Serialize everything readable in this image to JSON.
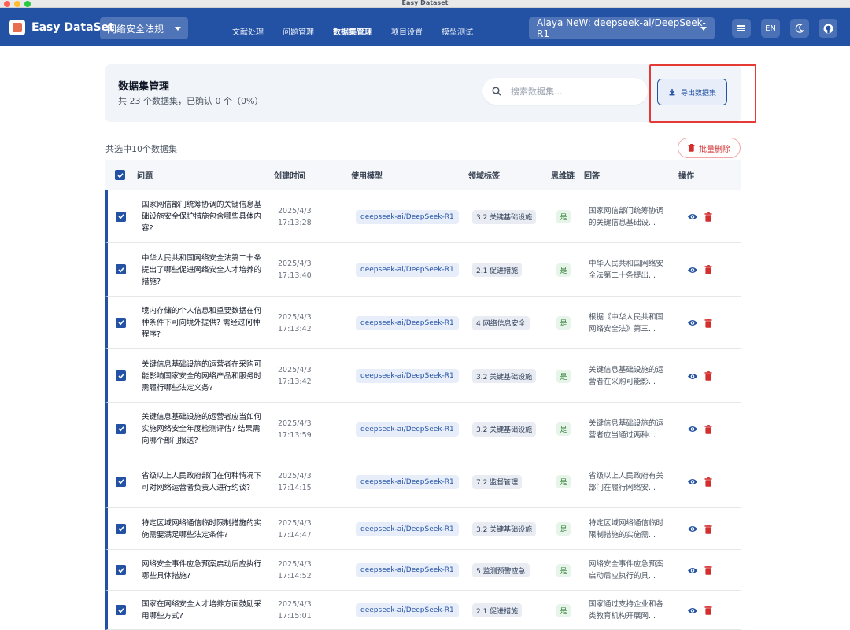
{
  "window": {
    "title": "Easy Dataset"
  },
  "appbar": {
    "app_name": "Easy DataSet",
    "project": "网络安全法规",
    "nav": [
      "文献处理",
      "问题管理",
      "数据集管理",
      "项目设置",
      "模型测试"
    ],
    "active_nav": 2,
    "model": "Alaya NeW: deepseek-ai/DeepSeek-R1",
    "lang": "EN",
    "icons": [
      "list-icon",
      "moon-icon",
      "github-icon"
    ]
  },
  "header": {
    "title": "数据集管理",
    "subtitle": "共 23 个数据集，已确认 0 个（0%）",
    "search_placeholder": "搜索数据集...",
    "export_label": "导出数据集"
  },
  "toolbar": {
    "selected": "共选中10个数据集",
    "batch_delete": "批量删除"
  },
  "table": {
    "columns": [
      "问题",
      "创建时间",
      "使用模型",
      "领域标签",
      "思维链",
      "回答",
      "操作"
    ],
    "rows": [
      {
        "question": "国家网信部门统筹协调的关键信息基础设施安全保护措施包含哪些具体内容?",
        "date": "2025/4/3",
        "time": "17:13:28",
        "model": "deepseek-ai/DeepSeek-R1",
        "tag": "3.2 关键基础设施",
        "cot": "是",
        "answer": "国家网信部门统筹协调的关键信息基础设..."
      },
      {
        "question": "中华人民共和国网络安全法第二十条提出了哪些促进网络安全人才培养的措施?",
        "date": "2025/4/3",
        "time": "17:13:40",
        "model": "deepseek-ai/DeepSeek-R1",
        "tag": "2.1 促进措施",
        "cot": "是",
        "answer": "中华人民共和国网络安全法第二十条提出..."
      },
      {
        "question": "境内存储的个人信息和重要数据在何种条件下可向境外提供? 需经过何种程序?",
        "date": "2025/4/3",
        "time": "17:13:42",
        "model": "deepseek-ai/DeepSeek-R1",
        "tag": "4 网络信息安全",
        "cot": "是",
        "answer": "根据《中华人民共和国网络安全法》第三..."
      },
      {
        "question": "关键信息基础设施的运营者在采购可能影响国家安全的网络产品和服务时需履行哪些法定义务?",
        "date": "2025/4/3",
        "time": "17:13:42",
        "model": "deepseek-ai/DeepSeek-R1",
        "tag": "3.2 关键基础设施",
        "cot": "是",
        "answer": "关键信息基础设施的运营者在采购可能影..."
      },
      {
        "question": "关键信息基础设施的运营者应当如何实施网络安全年度检测评估? 结果需向哪个部门报送?",
        "date": "2025/4/3",
        "time": "17:13:59",
        "model": "deepseek-ai/DeepSeek-R1",
        "tag": "3.2 关键基础设施",
        "cot": "是",
        "answer": "关键信息基础设施的运营者应当通过两种..."
      },
      {
        "question": "省级以上人民政府部门在何种情况下可对网络运营者负责人进行约谈?",
        "date": "2025/4/3",
        "time": "17:14:15",
        "model": "deepseek-ai/DeepSeek-R1",
        "tag": "7.2 监督管理",
        "cot": "是",
        "answer": "省级以上人民政府有关部门在履行网络安..."
      },
      {
        "question": "特定区域网络通信临时限制措施的实施需要满足哪些法定条件?",
        "date": "2025/4/3",
        "time": "17:14:47",
        "model": "deepseek-ai/DeepSeek-R1",
        "tag": "3.2 关键基础设施",
        "cot": "是",
        "answer": "特定区域网络通信临时限制措施的实施需..."
      },
      {
        "question": "网络安全事件应急预案启动后应执行哪些具体措施?",
        "date": "2025/4/3",
        "time": "17:14:52",
        "model": "deepseek-ai/DeepSeek-R1",
        "tag": "5 监测预警应急",
        "cot": "是",
        "answer": "网络安全事件应急预案启动后应执行的具..."
      },
      {
        "question": "国家在网络安全人才培养方面鼓励采用哪些方式?",
        "date": "2025/4/3",
        "time": "17:15:01",
        "model": "deepseek-ai/DeepSeek-R1",
        "tag": "2.1 促进措施",
        "cot": "是",
        "answer": "国家通过支持企业和各类教育机构开展网..."
      }
    ]
  },
  "colors": {
    "primary": "#2352a5",
    "danger": "#d32f2f",
    "success": "#2e7d32",
    "highlight": "#e53935"
  }
}
